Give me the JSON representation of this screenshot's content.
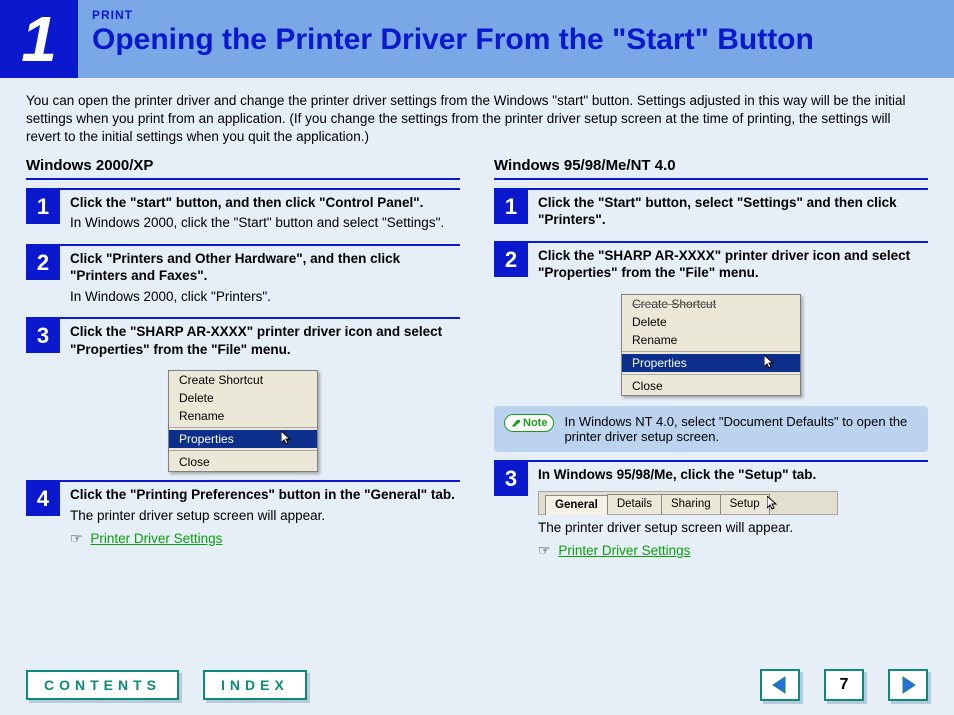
{
  "header": {
    "chapter_number": "1",
    "kicker": "PRINT",
    "title": "Opening the Printer Driver From the \"Start\" Button"
  },
  "intro": "You can open the printer driver and change the printer driver settings from the Windows \"start\" button. Settings adjusted in this way will be the initial settings when you print from an application. (If you change the settings from the printer driver setup screen at the time of printing, the settings will revert to the initial settings when you quit the application.)",
  "left": {
    "heading": "Windows 2000/XP",
    "steps": [
      {
        "n": "1",
        "bold": "Click the \"start\" button, and then click \"Control Panel\".",
        "sub": "In Windows 2000, click the \"Start\" button and select \"Settings\"."
      },
      {
        "n": "2",
        "bold": "Click \"Printers and Other Hardware\", and then click \"Printers and Faxes\".",
        "sub": "In Windows 2000, click \"Printers\"."
      },
      {
        "n": "3",
        "bold": "Click the \"SHARP AR-XXXX\" printer driver icon and select \"Properties\" from the \"File\" menu."
      },
      {
        "n": "4",
        "bold": "Click the \"Printing Preferences\" button in the \"General\" tab.",
        "sub": "The printer driver setup screen will appear."
      }
    ],
    "link_label": "Printer Driver Settings"
  },
  "right": {
    "heading": "Windows 95/98/Me/NT 4.0",
    "steps": [
      {
        "n": "1",
        "bold": "Click the \"Start\" button, select \"Settings\" and then click \"Printers\"."
      },
      {
        "n": "2",
        "bold": "Click the \"SHARP AR-XXXX\" printer driver icon and select \"Properties\" from the \"File\" menu."
      },
      {
        "n": "3",
        "bold": "In Windows 95/98/Me, click the \"Setup\" tab."
      }
    ],
    "note_label": "Note",
    "note": "In Windows NT 4.0, select \"Document Defaults\" to open the printer driver setup screen.",
    "appear": "The printer driver setup screen will appear.",
    "link_label": "Printer Driver Settings"
  },
  "ctx_menu": {
    "items": [
      "Create Shortcut",
      "Delete",
      "Rename",
      "Properties",
      "Close"
    ],
    "selected_index": 3
  },
  "tabs": {
    "items": [
      "General",
      "Details",
      "Sharing",
      "Setup"
    ],
    "active_index": 0
  },
  "nav": {
    "contents": "CONTENTS",
    "index": "INDEX",
    "page": "7"
  }
}
